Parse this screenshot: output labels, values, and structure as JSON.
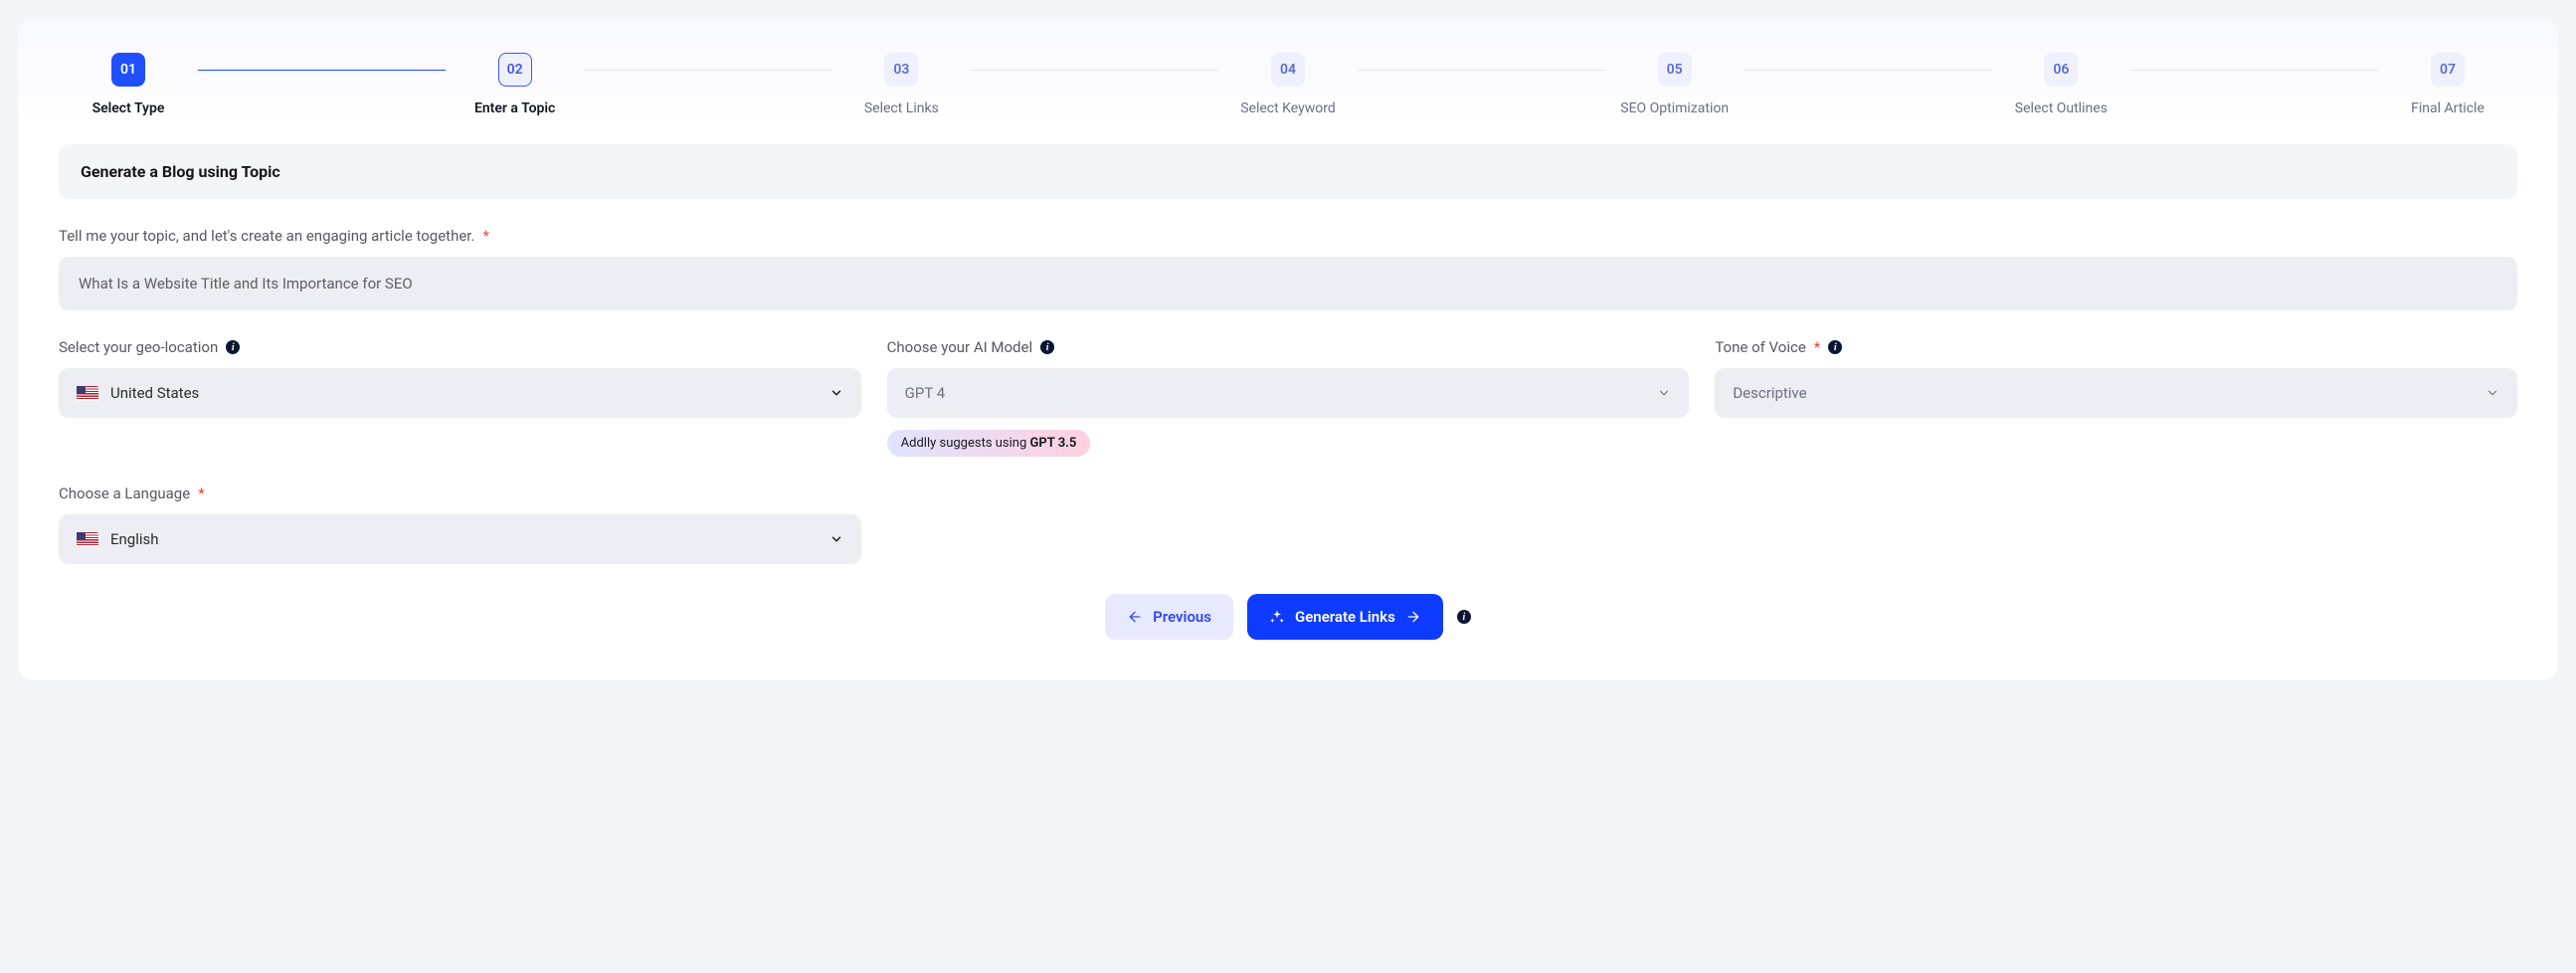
{
  "stepper": {
    "steps": [
      {
        "num": "01",
        "label": "Select Type",
        "state": "completed"
      },
      {
        "num": "02",
        "label": "Enter a Topic",
        "state": "active"
      },
      {
        "num": "03",
        "label": "Select Links",
        "state": "future"
      },
      {
        "num": "04",
        "label": "Select Keyword",
        "state": "future"
      },
      {
        "num": "05",
        "label": "SEO Optimization",
        "state": "future"
      },
      {
        "num": "06",
        "label": "Select Outlines",
        "state": "future"
      },
      {
        "num": "07",
        "label": "Final Article",
        "state": "future"
      }
    ]
  },
  "section": {
    "title": "Generate a Blog using Topic"
  },
  "topic": {
    "label": "Tell me your topic, and let's create an engaging article together.",
    "value": "What Is a Website Title and Its Importance for SEO"
  },
  "geo": {
    "label": "Select your geo-location",
    "value": "United States"
  },
  "model": {
    "label": "Choose your AI Model",
    "value": "GPT 4",
    "suggest_prefix": "Addlly suggests using ",
    "suggest_bold": "GPT 3.5"
  },
  "tone": {
    "label": "Tone of Voice",
    "value": "Descriptive"
  },
  "language": {
    "label": "Choose a Language",
    "value": "English"
  },
  "buttons": {
    "previous": "Previous",
    "generate": "Generate Links"
  }
}
